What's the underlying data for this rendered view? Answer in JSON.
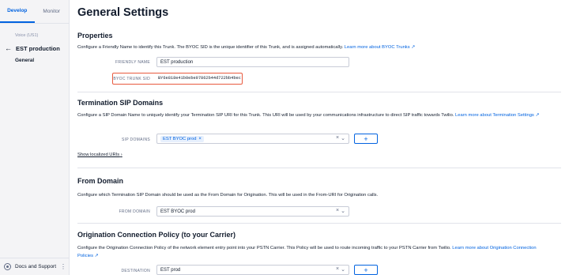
{
  "sidebar": {
    "tabs": [
      {
        "label": "Develop",
        "active": true
      },
      {
        "label": "Monitor",
        "active": false
      }
    ],
    "crumb": "Voice (US1)",
    "back_label": "EST production",
    "current": "General",
    "footer_label": "Docs and Support"
  },
  "page": {
    "title": "General Settings"
  },
  "properties": {
    "heading": "Properties",
    "desc": "Configure a Friendly Name to identify this Trunk. The BYOC SID is the unique identifier of this Trunk, and is assigned automatically.",
    "link": "Learn more about BYOC Trunks ↗",
    "friendly_name_label": "FRIENDLY NAME",
    "friendly_name_value": "EST production",
    "sid_label": "BYOC TRUNK SID",
    "sid_value": "BY6e818e41b0ebe97862b44d722bb4bec"
  },
  "termination": {
    "heading": "Termination SIP Domains",
    "desc": "Configure a SIP Domain Name to uniquely identify your Termination SIP URI for this Trunk. This URI will be used by your communications infrastructure to direct SIP traffic towards Twilio.",
    "link": "Learn more about Termination Settings ↗",
    "label": "SIP DOMAINS",
    "chip": "EST BYOC prod",
    "show_link": "Show localized URIs",
    "add": "+"
  },
  "from_domain": {
    "heading": "From Domain",
    "desc": "Configure which Termination SIP Domain should be used as the From Domain for Origination. This will be used in the From-URI for Origination calls.",
    "label": "FROM DOMAIN",
    "value": "EST BYOC prod"
  },
  "origination": {
    "heading": "Origination Connection Policy (to your Carrier)",
    "desc": "Configure the Origination Connection Policy of the network element entry point into your PSTN Carrier. This Policy will be used to route incoming traffic to your PSTN Carrier from Twilio.",
    "link": "Learn more about Origination Connection Policies ↗",
    "label": "DESTINATION",
    "value": "EST prod",
    "add": "+"
  },
  "colors": {
    "accent": "#0263e0",
    "highlight": "#e85a3f"
  }
}
